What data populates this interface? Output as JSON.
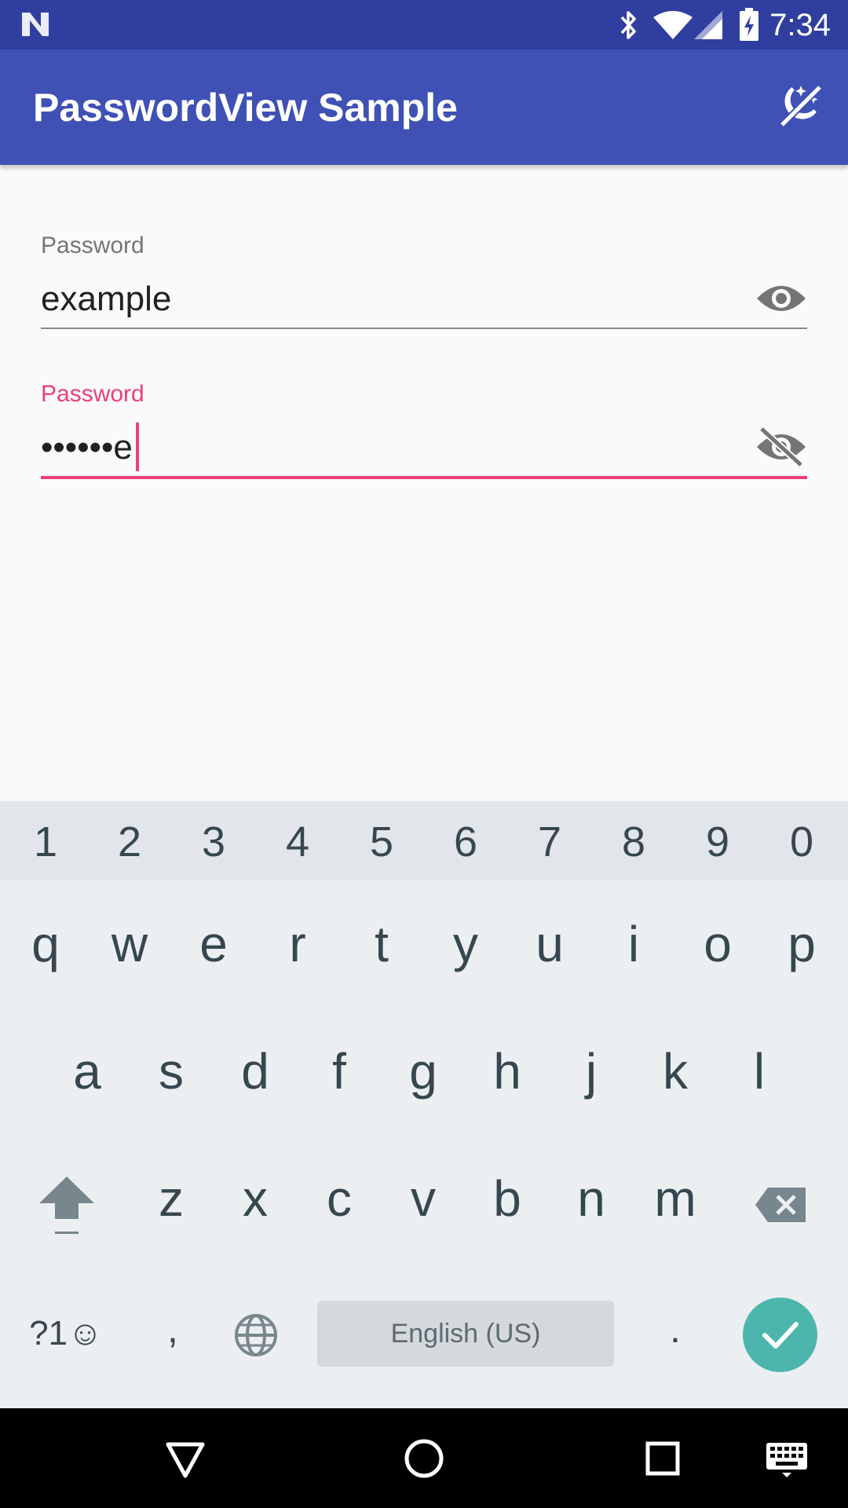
{
  "status_bar": {
    "time": "7:34",
    "icons": [
      "notification-n-icon",
      "bluetooth-icon",
      "wifi-icon",
      "signal-icon",
      "battery-charging-icon"
    ]
  },
  "app_bar": {
    "title": "PasswordView Sample",
    "action_icon": "theme-toggle-icon"
  },
  "fields": [
    {
      "label": "Password",
      "value": "example",
      "toggle_icon": "eye-icon",
      "focused": false
    },
    {
      "label": "Password",
      "value": "••••••e",
      "toggle_icon": "eye-off-icon",
      "focused": true
    }
  ],
  "colors": {
    "primary": "#3f51b5",
    "primary_dark": "#303f9f",
    "accent": "#ec407a",
    "enter_key": "#4db6ac"
  },
  "keyboard": {
    "number_row": [
      "1",
      "2",
      "3",
      "4",
      "5",
      "6",
      "7",
      "8",
      "9",
      "0"
    ],
    "row1": [
      "q",
      "w",
      "e",
      "r",
      "t",
      "y",
      "u",
      "i",
      "o",
      "p"
    ],
    "row2": [
      "a",
      "s",
      "d",
      "f",
      "g",
      "h",
      "j",
      "k",
      "l"
    ],
    "row3": [
      "z",
      "x",
      "c",
      "v",
      "b",
      "n",
      "m"
    ],
    "symbols_key": "?1☺",
    "comma_key": ",",
    "space_label": "English (US)",
    "period_key": ".",
    "icons": [
      "shift-icon",
      "backspace-icon",
      "globe-icon",
      "enter-check-icon"
    ]
  },
  "nav_bar": {
    "icons": [
      "back-icon",
      "home-icon",
      "recents-icon",
      "keyboard-switch-icon"
    ]
  }
}
